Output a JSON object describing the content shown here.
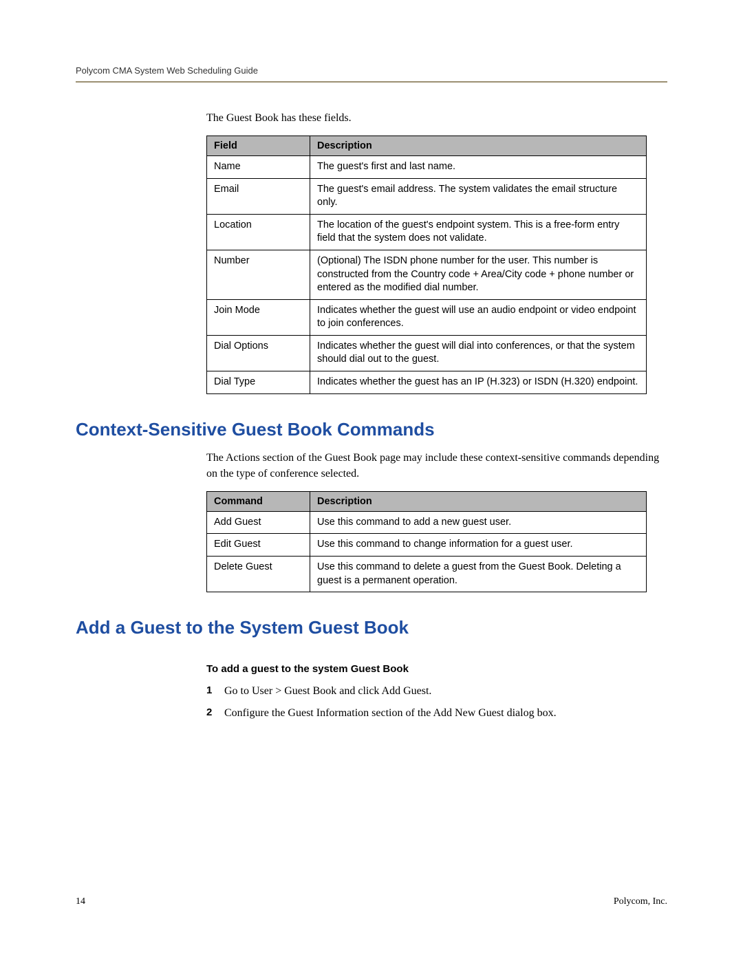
{
  "header": "Polycom CMA System Web Scheduling Guide",
  "intro": "The Guest Book has these fields.",
  "fields_table": {
    "col1": "Field",
    "col2": "Description",
    "rows": [
      {
        "field": "Name",
        "desc": "The guest's first and last name."
      },
      {
        "field": "Email",
        "desc": "The guest's email address. The system validates the email structure only."
      },
      {
        "field": "Location",
        "desc": "The location of the guest's endpoint system. This is a free-form entry field that the system does not validate."
      },
      {
        "field": "Number",
        "desc": "(Optional) The ISDN phone number for the user. This number is constructed from the Country code + Area/City code + phone number or entered as the modified dial number."
      },
      {
        "field": "Join Mode",
        "desc": "Indicates whether the guest will use an audio endpoint or video endpoint to join conferences."
      },
      {
        "field": "Dial Options",
        "desc": "Indicates whether the guest will dial into conferences, or that the system should dial out to the guest."
      },
      {
        "field": "Dial Type",
        "desc": "Indicates whether the guest has an IP (H.323) or ISDN (H.320) endpoint."
      }
    ]
  },
  "section1_title": "Context-Sensitive Guest Book Commands",
  "section1_intro": "The Actions section of the Guest Book page may include these context-sensitive commands depending on the type of conference selected.",
  "commands_table": {
    "col1": "Command",
    "col2": "Description",
    "rows": [
      {
        "cmd": "Add Guest",
        "desc": "Use this command to add a new guest user."
      },
      {
        "cmd": "Edit Guest",
        "desc": "Use this command to change information for a guest user."
      },
      {
        "cmd": "Delete Guest",
        "desc": "Use this command to delete a guest from the Guest Book. Deleting a guest is a permanent operation."
      }
    ]
  },
  "section2_title": "Add a Guest to the System Guest Book",
  "procedure_title": "To add a guest to the system Guest Book",
  "steps": [
    "Go to User > Guest Book and click Add Guest.",
    "Configure the Guest Information section of the Add New Guest dialog box."
  ],
  "footer": {
    "page": "14",
    "company": "Polycom, Inc."
  }
}
